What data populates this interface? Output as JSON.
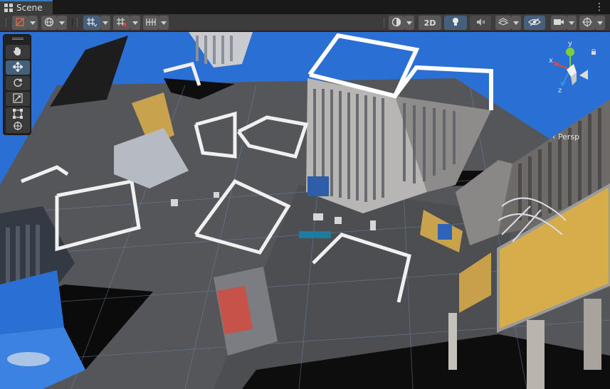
{
  "window": {
    "tab_label": "Scene",
    "menu_glyph": "⋮"
  },
  "toolbar": {
    "two_d_label": "2D",
    "left_icons": [
      "draw-mode-icon",
      "globe-icon",
      "grid-snap-icon",
      "grid-increment-icon",
      "snap-settings-icon"
    ],
    "right_icons": [
      "shading-icon",
      "light-bulb-icon",
      "audio-icon",
      "effects-icon",
      "hidden-visibility-icon",
      "camera-icon",
      "gizmos-icon"
    ]
  },
  "tools": {
    "items": [
      "hand-tool",
      "move-tool",
      "rotate-tool",
      "scale-tool",
      "rect-tool",
      "transform-tool"
    ],
    "active": "move-tool"
  },
  "gizmo": {
    "y_label": "y",
    "x_label": "x",
    "z_label": "z",
    "projection_label": "‹ Persp"
  },
  "colors": {
    "accent": "#3a79bb",
    "active_button": "#46607c",
    "sky": "#2a6fd4",
    "ground": "#55565a",
    "gizmo_x": "#e0463b",
    "gizmo_y": "#7ecd3a",
    "gizmo_z": "#3d8ee0"
  }
}
